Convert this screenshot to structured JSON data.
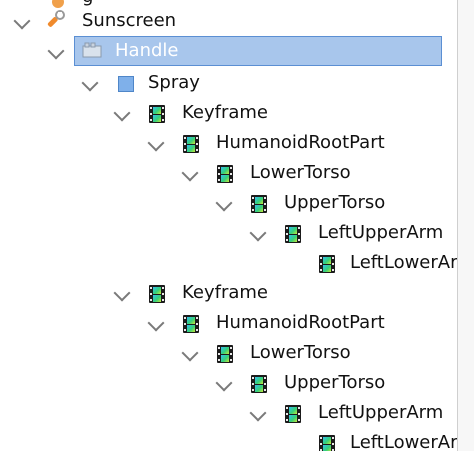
{
  "tree": {
    "partial_top_label": "g",
    "items": [
      {
        "label": "Sunscreen",
        "icon": "wrench-brush-icon"
      },
      {
        "label": "Handle",
        "icon": "part-block-icon",
        "selected": true
      },
      {
        "label": "Spray",
        "icon": "cube-icon"
      },
      {
        "label": "Keyframe",
        "icon": "filmstrip-icon"
      },
      {
        "label": "HumanoidRootPart",
        "icon": "filmstrip-icon"
      },
      {
        "label": "LowerTorso",
        "icon": "filmstrip-icon"
      },
      {
        "label": "UpperTorso",
        "icon": "filmstrip-icon"
      },
      {
        "label": "LeftUpperArm",
        "icon": "filmstrip-icon"
      },
      {
        "label": "LeftLowerArm",
        "icon": "filmstrip-icon"
      },
      {
        "label": "Keyframe",
        "icon": "filmstrip-icon"
      },
      {
        "label": "HumanoidRootPart",
        "icon": "filmstrip-icon"
      },
      {
        "label": "LowerTorso",
        "icon": "filmstrip-icon"
      },
      {
        "label": "UpperTorso",
        "icon": "filmstrip-icon"
      },
      {
        "label": "LeftUpperArm",
        "icon": "filmstrip-icon"
      },
      {
        "label": "LeftLowerArm",
        "icon": "filmstrip-icon"
      }
    ]
  },
  "colors": {
    "selection_bg": "#a8c6ec",
    "selection_border": "#5b8fd3",
    "text": "#111111"
  }
}
